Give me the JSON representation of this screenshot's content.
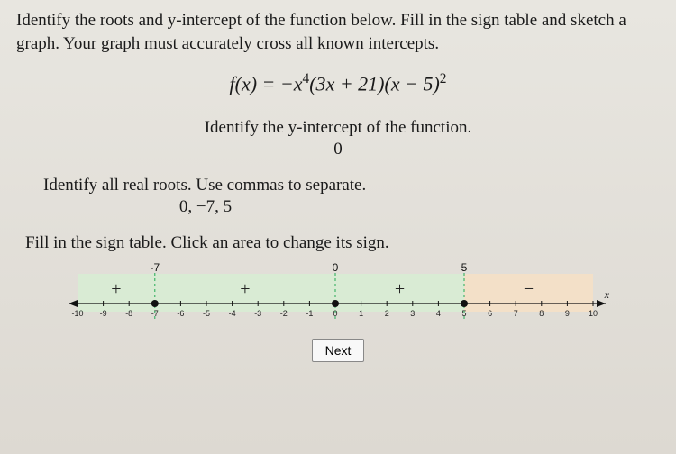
{
  "instructions": "Identify the roots and y-intercept of the function below. Fill in the sign table and sketch a graph. Your graph must accurately cross all known intercepts.",
  "equation_html": "f(x) = −x⁴(3x + 21)(x − 5)²",
  "yint_prompt": "Identify the y-intercept of the function.",
  "yint_answer": "0",
  "roots_prompt": "Identify all real roots. Use commas to separate.",
  "roots_answer": "0, −7, 5",
  "fill_prompt": "Fill in the sign table. Click an area to change its sign.",
  "next_label": "Next",
  "chart_data": {
    "type": "signtable",
    "axis_label": "x",
    "ticks": [
      -10,
      -9,
      -8,
      -7,
      -6,
      -5,
      -4,
      -3,
      -2,
      -1,
      0,
      1,
      2,
      3,
      4,
      5,
      6,
      7,
      8,
      9,
      10
    ],
    "critical_points": [
      -7,
      0,
      5
    ],
    "critical_labels": [
      "-7",
      "0",
      "5"
    ],
    "regions": [
      {
        "from": -10,
        "to": -7,
        "sign": "+"
      },
      {
        "from": -7,
        "to": 0,
        "sign": "+"
      },
      {
        "from": 0,
        "to": 5,
        "sign": "+"
      },
      {
        "from": 5,
        "to": 10,
        "sign": "−"
      }
    ],
    "region_colors": {
      "+": "#d9ebd4",
      "-": "#f3e0c8"
    }
  }
}
